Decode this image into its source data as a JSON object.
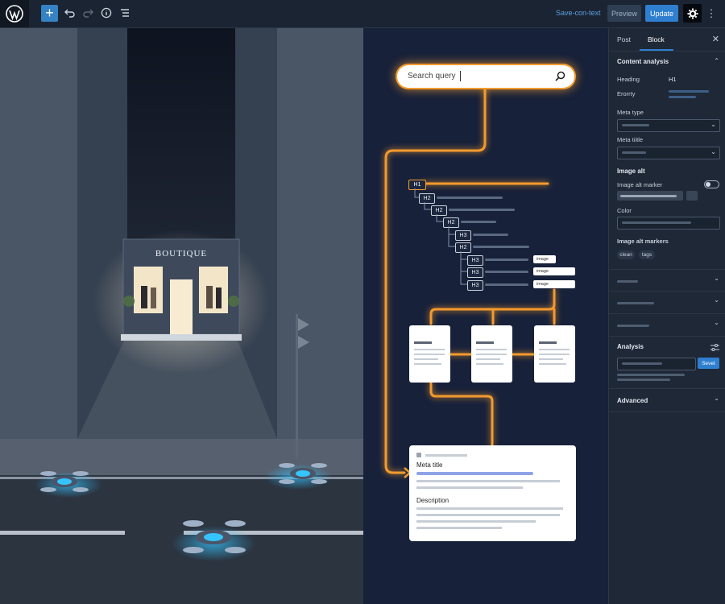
{
  "toolbar": {
    "save_label": "Save-con-text",
    "preview_label": "Preview",
    "update_label": "Update"
  },
  "sidebar": {
    "tabs": [
      {
        "label": "Post"
      },
      {
        "label": "Block"
      }
    ],
    "content_analysis": {
      "title": "Content analysis",
      "heading_label": "Heading",
      "heading_value": "H1",
      "priority_label": "Erorrty"
    },
    "meta_type_label": "Meta type",
    "meta_title_label": "Meta tiitle",
    "image_alt": {
      "title": "Image alt",
      "marker_label": "Image alt marker",
      "color_label": "Color",
      "markers_label": "Image alt markers",
      "chips": [
        "clean",
        "tags"
      ]
    },
    "analysis": {
      "title": "Analysis",
      "button_label": "Sevet"
    },
    "advanced_title": "Advanced"
  },
  "scene": {
    "shop_sign": "BOUTIQUE"
  },
  "seo": {
    "search_placeholder": "Search query",
    "headings": [
      "H1",
      "H2",
      "H2",
      "H2",
      "H3",
      "H2",
      "H3",
      "H3",
      "H3"
    ],
    "image_labels": [
      "image",
      "image",
      "image"
    ],
    "meta_card": {
      "meta_title_label": "Meta title",
      "description_label": "Description"
    }
  },
  "colors": {
    "accent": "#2f7fd0",
    "glow": "#f39a2d",
    "drone_light": "#35c4ff"
  }
}
